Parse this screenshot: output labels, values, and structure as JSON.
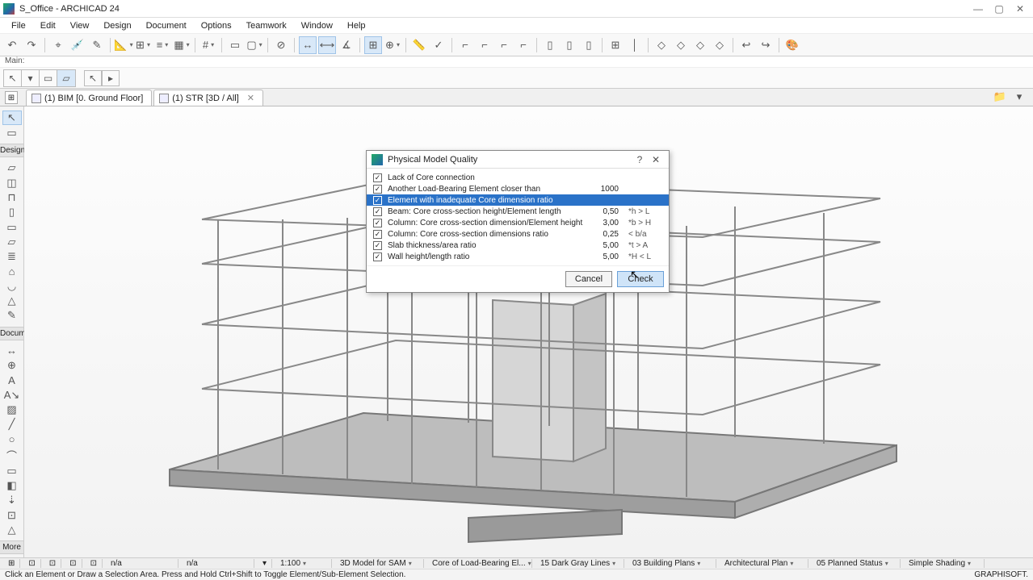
{
  "title": "S_Office - ARCHICAD 24",
  "menu": [
    "File",
    "Edit",
    "View",
    "Design",
    "Document",
    "Options",
    "Teamwork",
    "Window",
    "Help"
  ],
  "labelbar": "Main:",
  "tabs": [
    {
      "label": "(1) BIM [0. Ground Floor]",
      "closable": false
    },
    {
      "label": "(1) STR [3D / All]",
      "closable": true
    }
  ],
  "sidebar": {
    "h1": "Design",
    "h2": "Docume",
    "h3": "More"
  },
  "dialog": {
    "title": "Physical Model Quality",
    "rows": [
      {
        "chk": true,
        "label": "Lack of Core connection",
        "val": "",
        "hint": ""
      },
      {
        "chk": true,
        "label": "Another Load-Bearing Element closer than",
        "val": "1000",
        "hint": ""
      },
      {
        "chk": true,
        "label": "Element with inadequate Core dimension ratio",
        "val": "",
        "hint": "",
        "selected": true
      },
      {
        "chk": true,
        "label": "Beam: Core cross-section height/Element length",
        "val": "0,50",
        "hint": "*h > L"
      },
      {
        "chk": true,
        "label": "Column: Core cross-section dimension/Element height",
        "val": "3,00",
        "hint": "*b > H"
      },
      {
        "chk": true,
        "label": "Column: Core cross-section dimensions ratio",
        "val": "0,25",
        "hint": "< b/a"
      },
      {
        "chk": true,
        "label": "Slab thickness/area ratio",
        "val": "5,00",
        "hint": "*t > A"
      },
      {
        "chk": true,
        "label": "Wall height/length ratio",
        "val": "5,00",
        "hint": "*H < L"
      }
    ],
    "cancel": "Cancel",
    "check": "Check"
  },
  "status1": {
    "scale": "1:100",
    "model": "3D Model for SAM",
    "core": "Core of Load-Bearing El...",
    "lines": "15 Dark Gray Lines",
    "plans": "03 Building Plans",
    "arch": "Architectural Plan",
    "planned": "05 Planned Status",
    "shade": "Simple Shading",
    "na": "n/a"
  },
  "status2": {
    "hint": "Click an Element or Draw a Selection Area. Press and Hold Ctrl+Shift to Toggle Element/Sub-Element Selection.",
    "brand": "GRAPHISOFT."
  }
}
